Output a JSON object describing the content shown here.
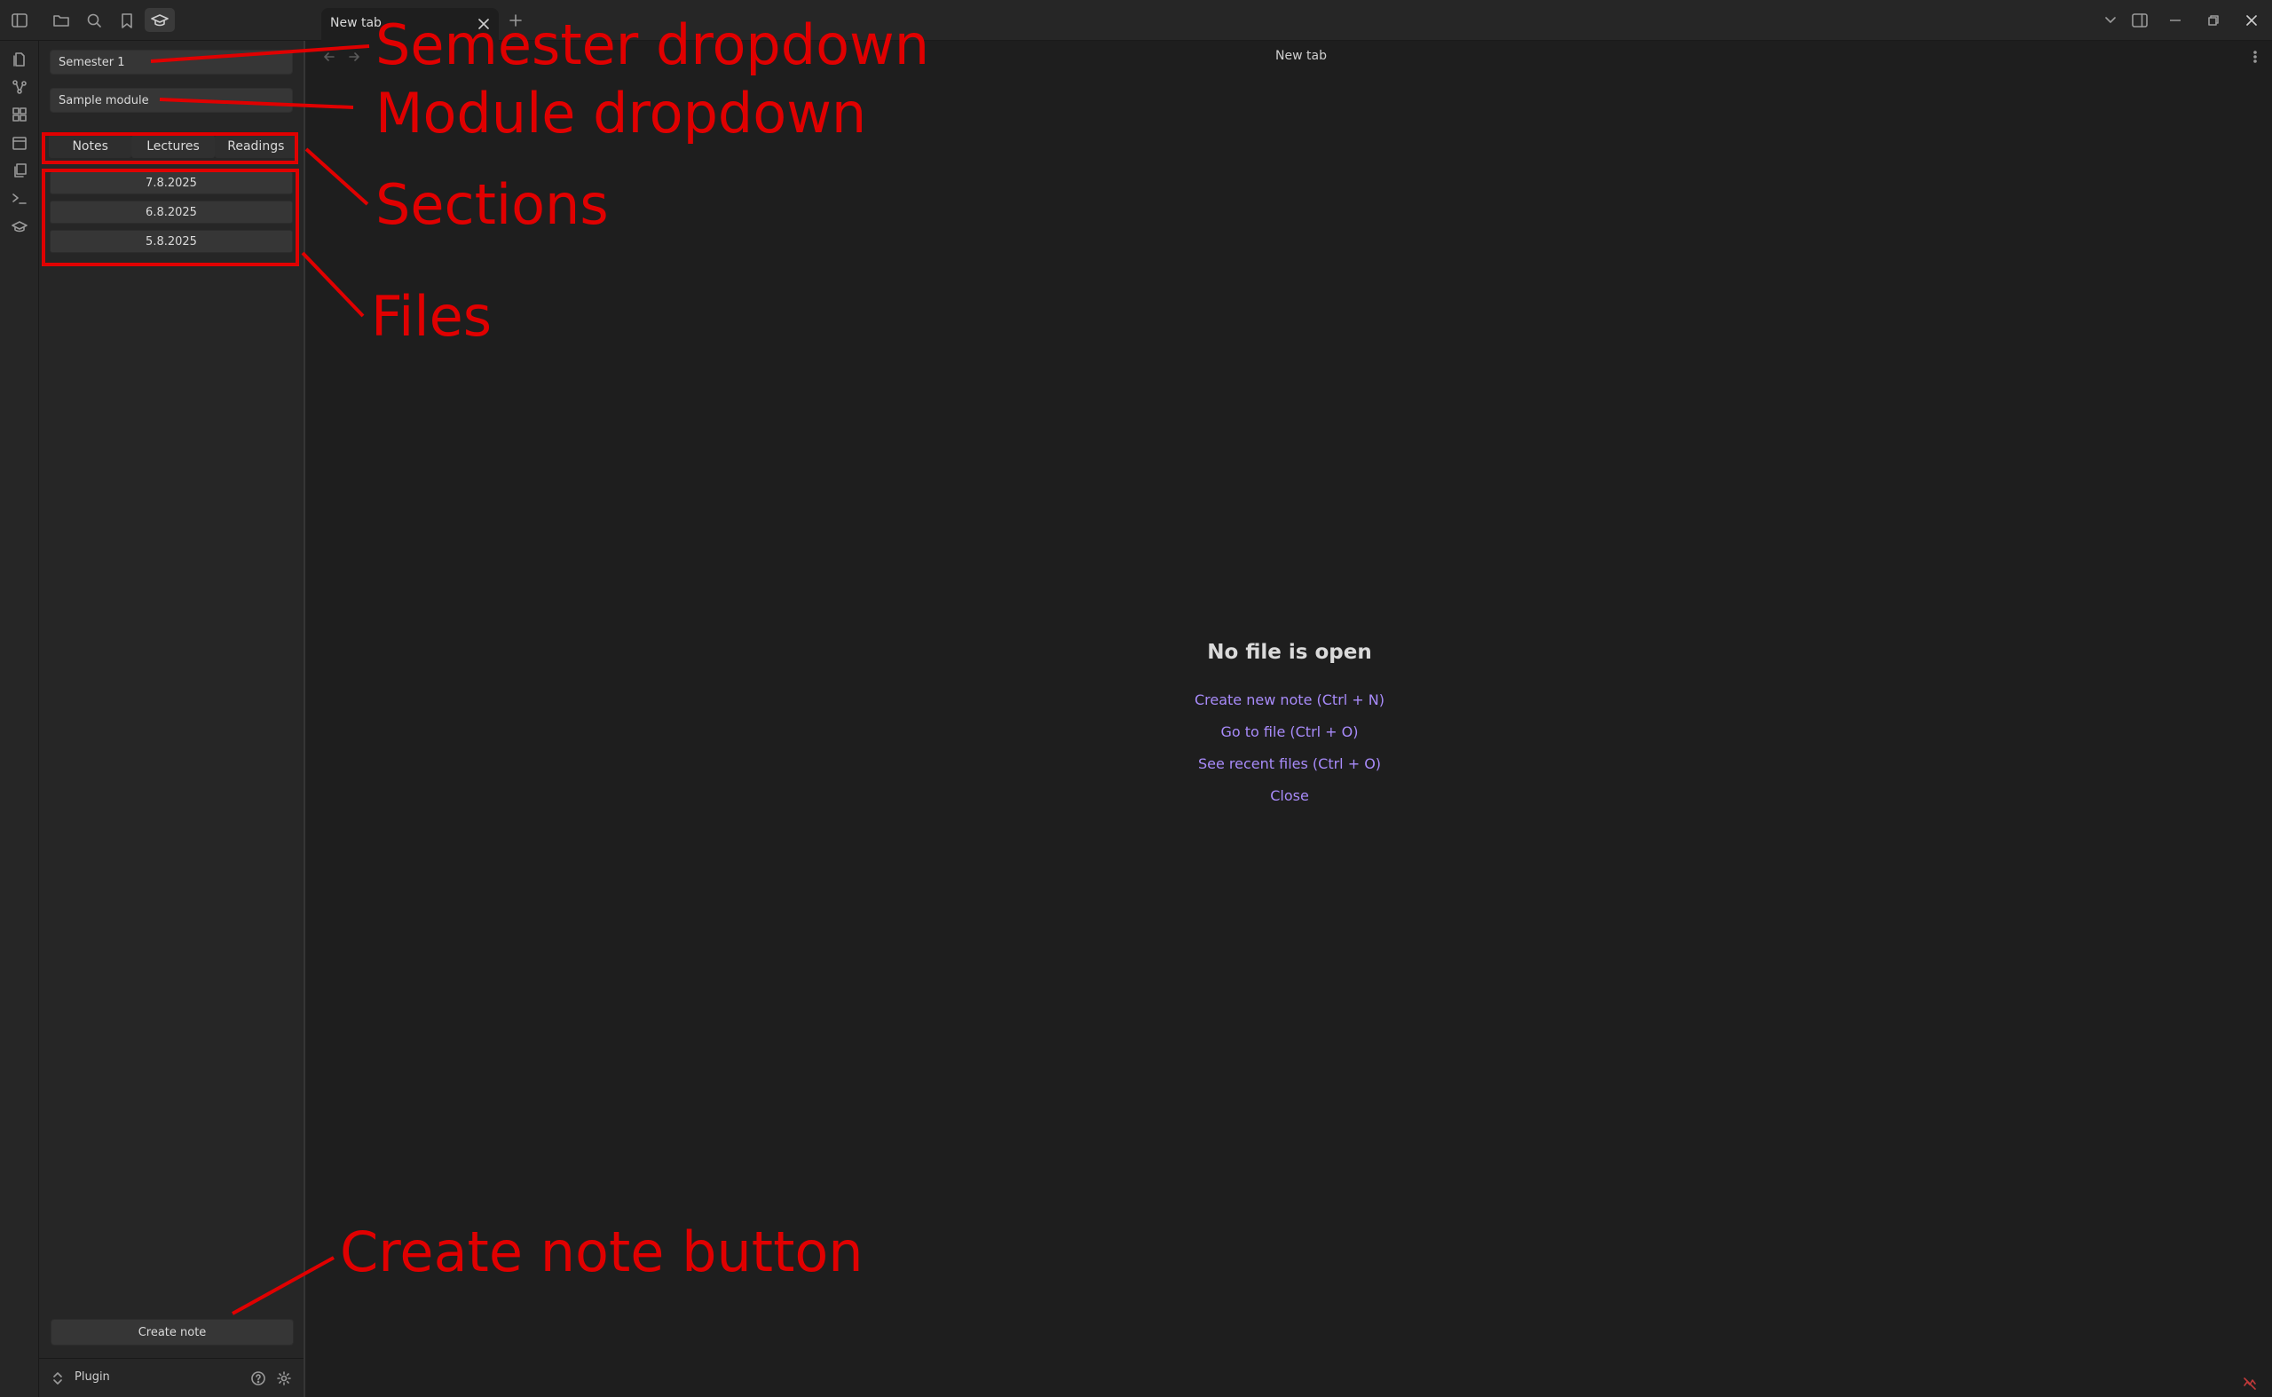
{
  "tab": {
    "title": "New tab"
  },
  "header": {
    "title": "New tab"
  },
  "sidebar": {
    "semester_dropdown": "Semester 1",
    "module_dropdown": "Sample module",
    "sections": [
      "Notes",
      "Lectures",
      "Readings"
    ],
    "files": [
      "7.8.2025",
      "6.8.2025",
      "5.8.2025"
    ],
    "create_note_label": "Create note",
    "footer_label": "Plugin"
  },
  "main": {
    "empty_title": "No file is open",
    "actions": [
      "Create new note (Ctrl + N)",
      "Go to file (Ctrl + O)",
      "See recent files (Ctrl + O)",
      "Close"
    ]
  },
  "annotations": {
    "semester": "Semester dropdown",
    "module": "Module dropdown",
    "sections": "Sections",
    "files": "Files",
    "create": "Create note button"
  },
  "colors": {
    "accent": "#a88bfa",
    "annotation": "#e00000",
    "background": "#1e1e1e",
    "panel": "#262626"
  }
}
